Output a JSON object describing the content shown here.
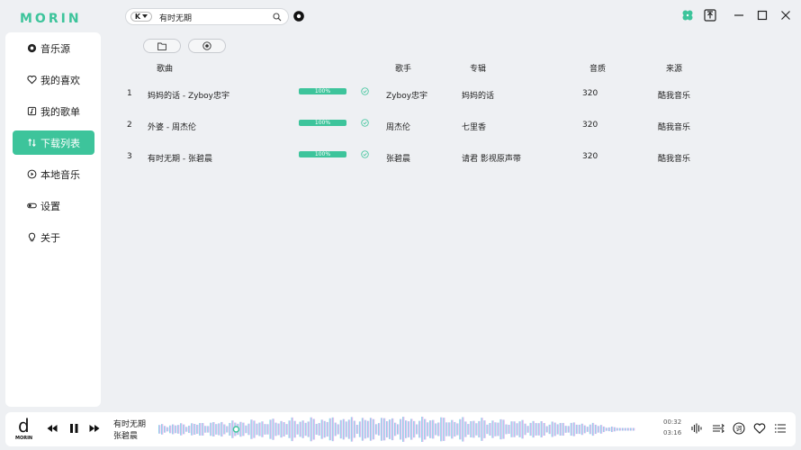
{
  "app": {
    "logo_text": "MORIN"
  },
  "sidebar": {
    "items": [
      {
        "label": "音乐源",
        "icon": "record-icon"
      },
      {
        "label": "我的喜欢",
        "icon": "heart-icon"
      },
      {
        "label": "我的歌单",
        "icon": "playlist-icon"
      },
      {
        "label": "下载列表",
        "icon": "sort-icon",
        "active": true
      },
      {
        "label": "本地音乐",
        "icon": "play-circle-icon"
      },
      {
        "label": "设置",
        "icon": "toggle-icon"
      },
      {
        "label": "关于",
        "icon": "bulb-icon"
      }
    ]
  },
  "search": {
    "source": "K",
    "value": "有时无期"
  },
  "table": {
    "headers": {
      "song": "歌曲",
      "singer": "歌手",
      "album": "专辑",
      "quality": "音质",
      "source": "来源"
    },
    "rows": [
      {
        "index": "1",
        "title": "妈妈的话 - Zyboy忠宇",
        "progress": "100%",
        "singer": "Zyboy忠宇",
        "album": "妈妈的话",
        "quality": "320",
        "source": "酷我音乐"
      },
      {
        "index": "2",
        "title": "外婆 - 周杰伦",
        "progress": "100%",
        "singer": "周杰伦",
        "album": "七里香",
        "quality": "320",
        "source": "酷我音乐"
      },
      {
        "index": "3",
        "title": "有时无期 - 张碧晨",
        "progress": "100%",
        "singer": "张碧晨",
        "album": "请君 影视原声带",
        "quality": "320",
        "source": "酷我音乐"
      }
    ]
  },
  "player": {
    "logo_letter": "d",
    "logo_text": "MORIN",
    "song": "有时无期",
    "singer": "张碧晨",
    "current_time": "00:32",
    "total_time": "03:16",
    "progress": 0.163,
    "lyrics_label": "词"
  },
  "colors": {
    "accent": "#3dc49b",
    "wave_played": "#6fe0e0",
    "wave_mid": "#a8c8f0",
    "wave_end": "#e8b8ec"
  }
}
